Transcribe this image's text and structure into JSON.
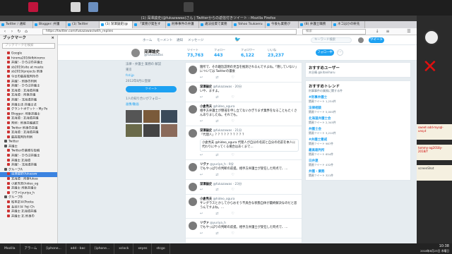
{
  "window_title": "(1) 深澤諭史(@fukazawas)さん | Twitterからの返信付きツイート - Mozilla Firefox",
  "tabs": [
    {
      "label": "Twitter / 通知"
    },
    {
      "label": "Blogger: 弁護"
    },
    {
      "label": "(1) Twitter"
    },
    {
      "label": "(1) 深澤諭史(@"
    },
    {
      "label": "「業務が発生す"
    },
    {
      "label": "刑事事件の弁護"
    },
    {
      "label": "違法投資で業務"
    },
    {
      "label": "Yahoo Tsukaeru"
    },
    {
      "label": "今後も業務が"
    },
    {
      "label": "(8) 弁護士職務"
    },
    {
      "label": "ネコはかの軒先"
    }
  ],
  "url": "https://twitter.com/fukazawas/with_replies",
  "search_placeholder": "検索",
  "sidebar": {
    "title": "ブックマーク",
    "search_placeholder": "ブックマークを検索",
    "items": [
      {
        "label": "Google",
        "folder": false
      },
      {
        "label": "hiroma2016kfbhiromx",
        "folder": false
      },
      {
        "label": "弁護! - ひろばの弁護士",
        "folder": false
      },
      {
        "label": "sb2019/site at maste",
        "folder": false
      },
      {
        "label": "sb2019/projects 刑事",
        "folder": false
      },
      {
        "label": "今日の最高裁判所の",
        "folder": false
      },
      {
        "label": "弁護! - 刑事の判例",
        "folder": false
      },
      {
        "label": "弁護! - ひろば弁護士",
        "folder": false
      },
      {
        "label": "北海道 : 北海道弁護",
        "folder": false
      },
      {
        "label": "北海道 : 刑事弁護",
        "folder": false
      },
      {
        "label": "弁護! - 北海道弁護",
        "folder": false
      },
      {
        "label": "弁護士法 弁護士法",
        "folder": false
      },
      {
        "label": "グラントポケット・My Po",
        "folder": false
      },
      {
        "label": "Blogger: 刑事弁護士",
        "folder": false
      },
      {
        "label": "北海道 : 北海道弁護",
        "folder": false
      },
      {
        "label": "判例 : 刑事弁護論文",
        "folder": false
      },
      {
        "label": "Twitter 刑事の弁護",
        "folder": false
      },
      {
        "label": "北海道 : 北海道弁護",
        "folder": false
      },
      {
        "label": "最高裁判所判例",
        "folder": false
      },
      {
        "label": "Twitter",
        "folder": true
      },
      {
        "label": "弁護士",
        "folder": true
      },
      {
        "label": "Twitterの業務な投稿",
        "folder": false
      },
      {
        "label": "弁護! - ひろば弁護士",
        "folder": false
      },
      {
        "label": "弁護士 北海道",
        "folder": false
      },
      {
        "label": "弁護! - 北海道弁護",
        "folder": false
      },
      {
        "label": "グループA",
        "folder": true
      },
      {
        "label": "深澤諭史(fukazaw",
        "folder": false,
        "selected": true
      },
      {
        "label": "北海道 : 刑事fukaa",
        "folder": false
      },
      {
        "label": "小倉秀夫(hideo_og",
        "folder": false
      },
      {
        "label": "弁護士 刑事弁護士",
        "folder": false
      },
      {
        "label": "リヴァ(yuriya_h",
        "folder": false
      },
      {
        "label": "グループB",
        "folder": true
      },
      {
        "label": "松本正平(Pooka",
        "folder": false
      },
      {
        "label": "長谷川平 Yoji Ch",
        "folder": false
      },
      {
        "label": "弁護士 北海道弁護",
        "folder": false
      },
      {
        "label": "弁護士 北 刑事の",
        "folder": false
      }
    ]
  },
  "twitter_nav": {
    "home": "ホーム",
    "moments": "モーメント",
    "notifications": "通知",
    "messages": "メッセージ",
    "search_placeholder": "キーワード検索",
    "tweet_button": "ツイート"
  },
  "profile": {
    "name": "深澤諭史",
    "handle": "@fukazawas",
    "stats": [
      {
        "label": "ツイート",
        "value": "73,763"
      },
      {
        "label": "フォロー",
        "value": "443"
      },
      {
        "label": "フォロワー",
        "value": "6,122"
      },
      {
        "label": "いいね",
        "value": "23,237"
      }
    ],
    "follow_button": "フォロー中",
    "left_lines": [
      {
        "text": "法律・弁護士 業務の 解説",
        "gray": true
      },
      {
        "text": "東京",
        "gray": true
      },
      {
        "text": "fcd.jp",
        "gray": false
      },
      {
        "text": "2012年8月に登録",
        "gray": true
      }
    ],
    "left_button": "ツイート",
    "followers_you_know": "1人の知り合いがフォロー",
    "media_label": "画像/動画"
  },
  "timeline": [
    {
      "name": "",
      "handle": "",
      "text": "箇所で、その趣旨説明の見当を推測されるんですよね。「隠していない」については Twitterの最後",
      "quote": ""
    },
    {
      "name": "深澤諭史",
      "handle": "@fukazawas · 20分",
      "text": "いや、ますよ。",
      "quote": ""
    },
    {
      "name": "小倉秀夫",
      "handle": "@hideo_ogura",
      "text": "相手方弁護士が懲戒を申し立てないかぎりまず業界をなることもたくさんありましたね。それでも。",
      "quote": ""
    },
    {
      "name": "深澤諭史",
      "handle": "@fukazawas · 21分",
      "text": "「代理人」？？？？？？？？？？",
      "quote": "小倉秀夫 @hideo_ogura 代理人が自分の名前と自分の名前を本人に代わりにやってくる場合はあくまで…"
    },
    {
      "name": "リヴァ",
      "handle": "@yuriya_h · 9分",
      "text": "でもやっぱりの判断の前提。相手方弁護士が受任した時点で、…",
      "quote": ""
    },
    {
      "name": "深澤諭史",
      "handle": "@fukazawas · 23分",
      "text": "",
      "quote": ""
    },
    {
      "name": "小倉秀夫",
      "handle": "@hideo_ogura",
      "text": "サングラスとかしてからおそう不具合な状態自体が最終解決なのだと思うんですよね。…",
      "quote": ""
    },
    {
      "name": "リヴァ",
      "handle": "@yuriya_h",
      "text": "でもやっぱりの判断の前提。相手方弁護士が受任した時点で、…",
      "quote": ""
    }
  ],
  "right_col": {
    "who_to_follow_title": "おすすめユーザー",
    "who_to_follow_name": "木谷晴 @kitaniharu",
    "trends_title": "おすすめトレンド",
    "trends_promo": "刑事事件の業務に関する件",
    "trends": [
      {
        "name": "#刑事弁護士",
        "desc": "関連ツイート 1,234件"
      },
      {
        "name": "法律相談",
        "desc": "関連ツイート 5,000件"
      },
      {
        "name": "北海道弁護士会",
        "desc": "関連ツイート 2,345件"
      },
      {
        "name": "弁護士会",
        "desc": "関連ツイート 3,210件"
      },
      {
        "name": "#弁護士懲戒",
        "desc": "関連ツイート 987件"
      },
      {
        "name": "最高裁判所",
        "desc": "関連ツイート 654件"
      },
      {
        "name": "日弁連",
        "desc": "関連ツイート 432件"
      },
      {
        "name": "弁護・業務",
        "desc": "関連ツイート 321件"
      }
    ]
  },
  "desktop_notes": [
    {
      "text": "sweet-add-mysql-unq.d"
    },
    {
      "text": "tommy-ag2018y-2018/Y"
    },
    {
      "text": "screenShot"
    }
  ],
  "taskbar": {
    "tasks": [
      {
        "label": "Mozilla",
        "active": false
      },
      {
        "label": "アラーム",
        "active": false
      },
      {
        "label": "[iphone...",
        "active": false
      },
      {
        "label": "add - bac",
        "active": false
      },
      {
        "label": "[iphone...",
        "active": false
      },
      {
        "label": "xclock",
        "active": false
      },
      {
        "label": "xeyes",
        "active": false
      },
      {
        "label": "stcgo",
        "active": false
      }
    ],
    "time": "10:38",
    "date": "2018年8月23日 木曜日"
  }
}
